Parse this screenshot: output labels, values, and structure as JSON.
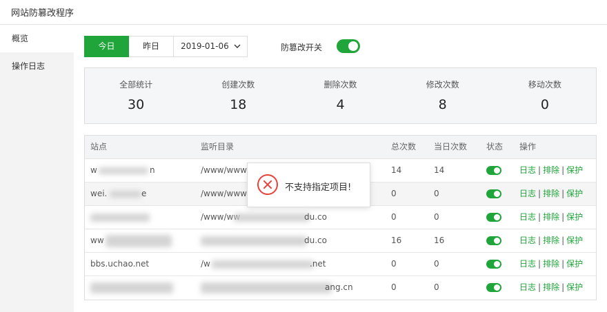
{
  "app": {
    "title": "网站防篡改程序"
  },
  "sidebar": {
    "items": [
      {
        "label": "概览"
      },
      {
        "label": "操作日志"
      }
    ]
  },
  "datebar": {
    "today": "今日",
    "yesterday": "昨日",
    "date": "2019-01-06"
  },
  "switch": {
    "label": "防篡改开关",
    "on": true
  },
  "stats": [
    {
      "label": "全部统计",
      "value": "30"
    },
    {
      "label": "创建次数",
      "value": "18"
    },
    {
      "label": "删除次数",
      "value": "4"
    },
    {
      "label": "修改次数",
      "value": "8"
    },
    {
      "label": "移动次数",
      "value": "0"
    }
  ],
  "table": {
    "headers": {
      "site": "站点",
      "dir": "监听目录",
      "total": "总次数",
      "today": "当日次数",
      "status": "状态",
      "ops": "操作"
    },
    "op_labels": {
      "log": "日志",
      "exclude": "排除",
      "protect": "保护",
      "sep": "|"
    },
    "rows": [
      {
        "site": "w",
        "site_tail": "n",
        "dir": "/www/www",
        "dir_tail": "",
        "total": "14",
        "today": "14",
        "status": true
      },
      {
        "site": "wei.",
        "site_tail": "e",
        "dir": "/www/www",
        "dir_tail": "",
        "total": "0",
        "today": "0",
        "status": true
      },
      {
        "site": "",
        "site_tail": "",
        "dir": "/www/ww",
        "dir_tail": "du.co",
        "total": "0",
        "today": "0",
        "status": true
      },
      {
        "site": "ww",
        "site_tail": "",
        "dir": "",
        "dir_tail": "du.co",
        "total": "16",
        "today": "16",
        "status": true
      },
      {
        "site": "bbs.uchao.net",
        "site_tail": "",
        "dir": "/w",
        "dir_tail": ".net",
        "total": "0",
        "today": "0",
        "status": true
      },
      {
        "site": "",
        "site_tail": "",
        "dir": "",
        "dir_tail": "ang.cn",
        "total": "0",
        "today": "0",
        "status": true
      }
    ]
  },
  "toast": {
    "message": "不支持指定项目!",
    "icon": "error-icon"
  },
  "colors": {
    "accent": "#20a53a",
    "error": "#e8413b"
  }
}
